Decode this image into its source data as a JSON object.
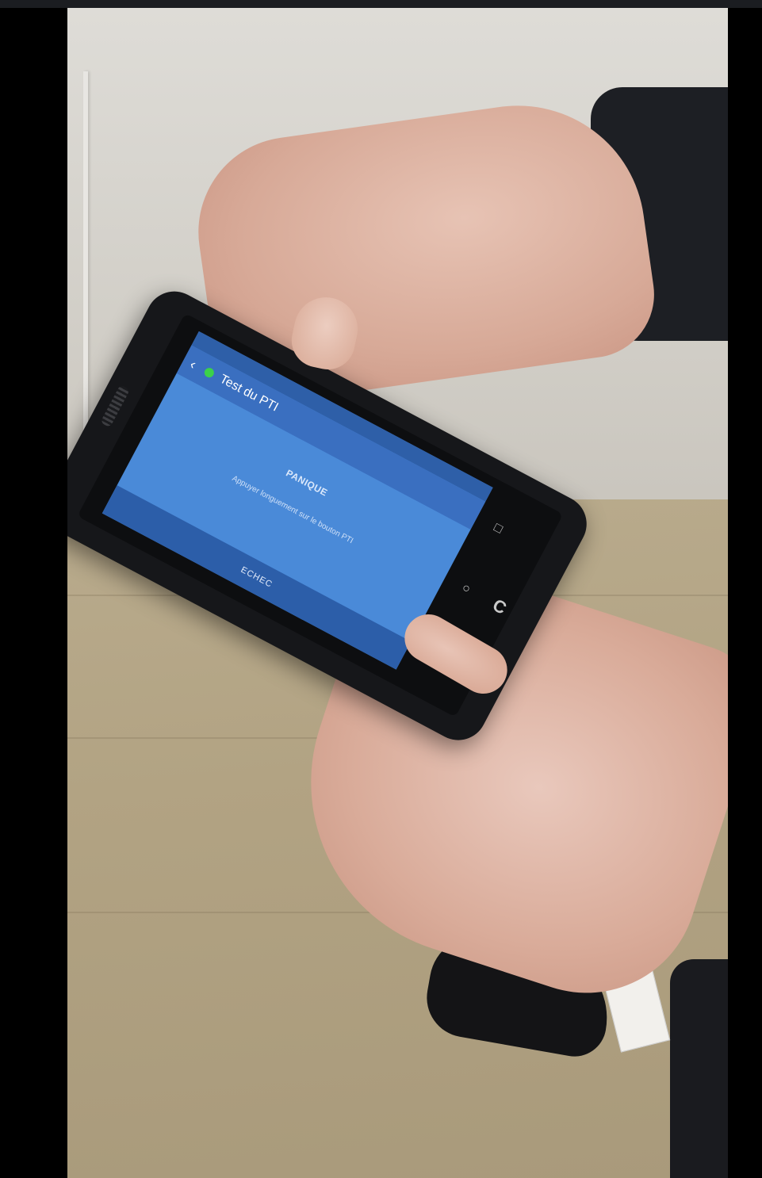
{
  "photo": {
    "description_label": "",
    "phone_screen": {
      "app_title": "Test du PTI",
      "back_icon": "back-arrow-icon",
      "status_indicator_color": "#3bd14a",
      "content_title": "PANIQUE",
      "content_subtitle": "Appuyer longuement sur le bouton PTI",
      "bottom_button_label": "ECHEC",
      "screen_color": "#4a8ad8"
    },
    "navbar": {
      "back": "◁",
      "home": "○",
      "recents": "□"
    },
    "logo_glyph": "C"
  }
}
